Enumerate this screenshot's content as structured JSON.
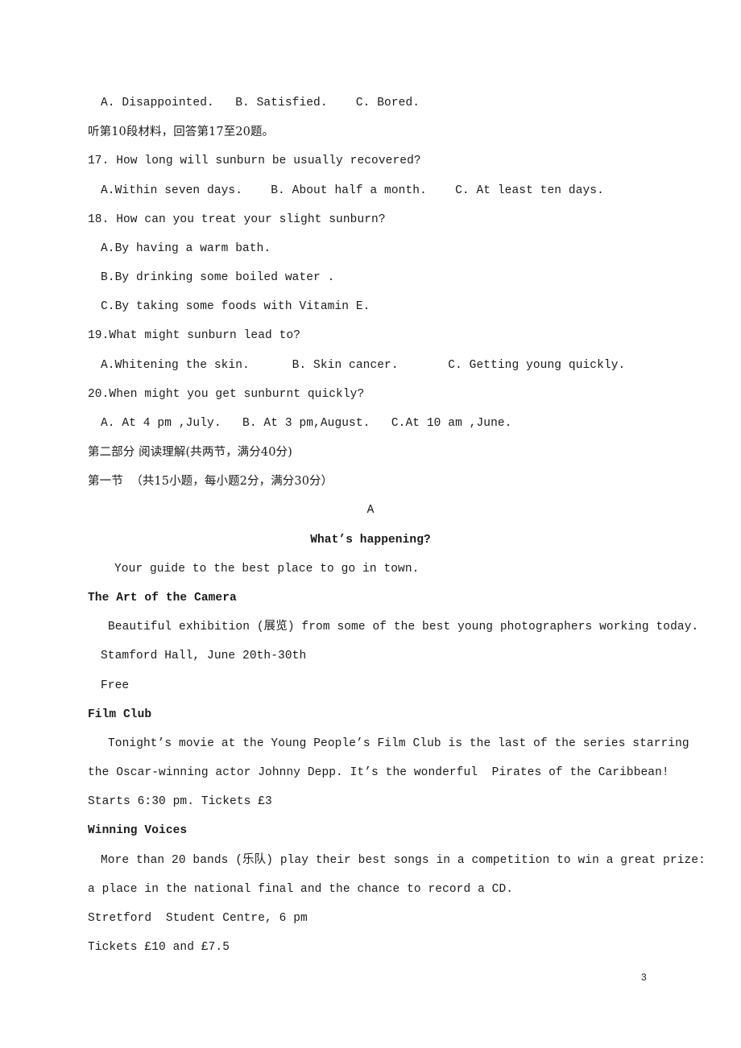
{
  "document": {
    "q16_options": "A. Disappointed.   B. Satisfied.    C. Bored.",
    "section10_instruction": "听第10段材料，回答第17至20题。",
    "questions": [
      {
        "number": "17.",
        "text": "17. How long will sunburn be usually recovered?",
        "options_line": "A.Within seven days.    B. About half a month.    C. At least ten days."
      },
      {
        "number": "18.",
        "text": "18. How can you treat your slight sunburn?",
        "options": [
          "A.By having a warm bath.",
          "B.By drinking some boiled water .",
          "C.By taking some foods with Vitamin E."
        ]
      },
      {
        "number": "19.",
        "text": "19.What might sunburn lead to?",
        "options_line": "A.Whitening the skin.      B. Skin cancer.       C. Getting young quickly."
      },
      {
        "number": "20.",
        "text": "20.When might you get sunburnt quickly?",
        "options_line": "A. At 4 pm ,July.   B. At 3 pm,August.   C.At 10 am ,June."
      }
    ],
    "part2_heading": "第二部分 阅读理解(共两节，满分40分)",
    "section1_heading": "第一节  （共15小题，每小题2分，满分30分）",
    "passage_label": "A",
    "passage_title": "What’s happening?",
    "passage_intro": "Your guide to the best place to go in town.",
    "events": [
      {
        "title": "The Art of the Camera",
        "lines": [
          "Beautiful exhibition (展览) from some of the best young photographers working today.",
          "Stamford Hall, June 20th-30th",
          "Free"
        ]
      },
      {
        "title": "Film Club",
        "lines": [
          "Tonight’s movie at the Young People’s Film Club is the last of the series starring",
          "the Oscar-winning actor Johnny Depp. It’s the wonderful  Pirates of the Caribbean!",
          "Starts 6:30 pm. Tickets £3"
        ]
      },
      {
        "title": "Winning Voices",
        "lines": [
          "More than 20 bands (乐队) play their best songs in a competition to win a great prize:",
          "a place in the national final and the chance to record a CD.",
          "Stretford  Student Centre, 6 pm",
          "Tickets £10 and £7.5"
        ]
      }
    ],
    "page_number": "3"
  }
}
